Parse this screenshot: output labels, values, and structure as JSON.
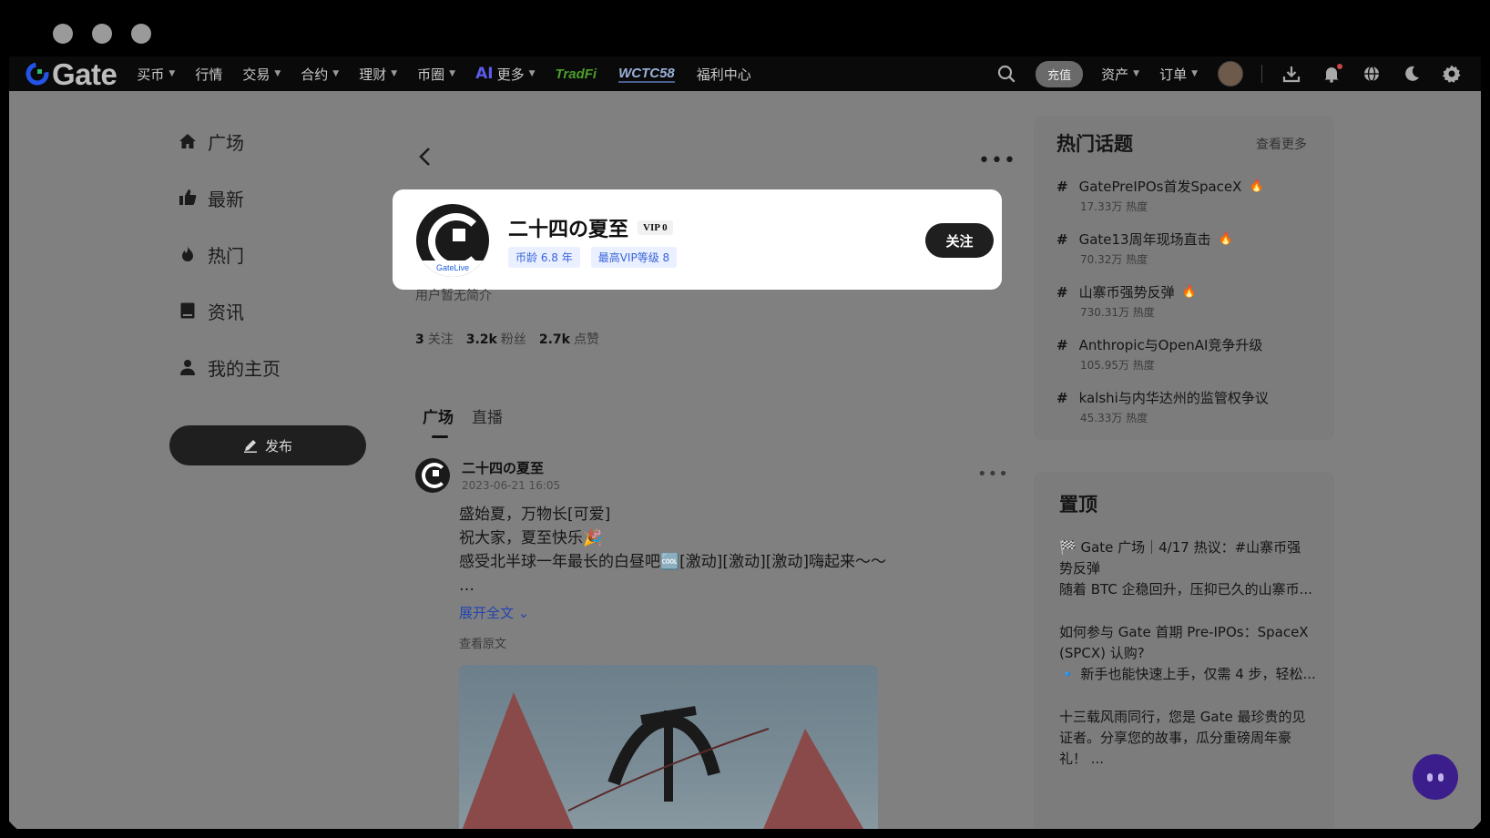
{
  "brand": {
    "name": "Gate"
  },
  "nav": [
    {
      "label": "买币",
      "dropdown": true
    },
    {
      "label": "行情",
      "dropdown": false
    },
    {
      "label": "交易",
      "dropdown": true
    },
    {
      "label": "合约",
      "dropdown": true
    },
    {
      "label": "理财",
      "dropdown": true
    },
    {
      "label": "币圈",
      "dropdown": true
    }
  ],
  "nav_more": {
    "ai": "AI",
    "label": "更多"
  },
  "nav_tradfi": "TradFi",
  "nav_wctc": "WCTC58",
  "nav_welfare": "福利中心",
  "topright": {
    "deposit": "充值",
    "assets": "资产",
    "orders": "订单"
  },
  "sidebar": {
    "items": [
      {
        "label": "广场",
        "icon": "home-icon"
      },
      {
        "label": "最新",
        "icon": "thumbs-up-icon"
      },
      {
        "label": "热门",
        "icon": "fire-icon"
      },
      {
        "label": "资讯",
        "icon": "news-icon"
      },
      {
        "label": "我的主页",
        "icon": "user-icon"
      }
    ],
    "publish": "发布"
  },
  "profile": {
    "name": "二十四の夏至",
    "vip": "VIP 0",
    "avatar_label": "GateLive",
    "tags": [
      "币龄 6.8 年",
      "最高VIP等级 8"
    ],
    "follow": "关注",
    "bio": "用户暂无简介",
    "stats": [
      {
        "value": "3",
        "label": "关注"
      },
      {
        "value": "3.2k",
        "label": "粉丝"
      },
      {
        "value": "2.7k",
        "label": "点赞"
      }
    ]
  },
  "tabs": [
    "广场",
    "直播"
  ],
  "post": {
    "author": "二十四の夏至",
    "time": "2023-06-21 16:05",
    "lines": [
      "盛始夏，万物长[可爱]",
      "祝大家，夏至快乐🎉",
      "感受北半球一年最长的白昼吧🆒[激动][激动][激动]嗨起来～～",
      "…"
    ],
    "expand": "展开全文",
    "original": "查看原文"
  },
  "hot": {
    "title": "热门话题",
    "see_more": "查看更多",
    "topics": [
      {
        "name": "GatePreIPOs首发SpaceX",
        "heat": "17.33万 热度",
        "fire": true
      },
      {
        "name": "Gate13周年现场直击",
        "heat": "70.32万 热度",
        "fire": true
      },
      {
        "name": "山寨币强势反弹",
        "heat": "730.31万 热度",
        "fire": true
      },
      {
        "name": "Anthropic与OpenAI竞争升级",
        "heat": "105.95万 热度",
        "fire": false
      },
      {
        "name": "kalshi与内华达州的监管权争议",
        "heat": "45.33万 热度",
        "fire": false
      }
    ]
  },
  "pinned": {
    "title": "置顶",
    "items": [
      {
        "line1": "🏁 Gate 广场｜4/17 热议：#山寨币强势反弹",
        "line2": "随着 BTC 企稳回升，压抑已久的山寨币..."
      },
      {
        "line1": "如何参与 Gate 首期 Pre-IPOs：SpaceX (SPCX) 认购?",
        "line2": "🔹 新手也能快速上手，仅需 4 步，轻松..."
      },
      {
        "line1": "十三载风雨同行，您是 Gate 最珍贵的见证者。分享您的故事，瓜分重磅周年豪礼！ ...",
        "line2": ""
      }
    ]
  },
  "colors": {
    "overlay": "#808080",
    "accent_blue": "#3764d8",
    "fire": "#b23a2a"
  }
}
